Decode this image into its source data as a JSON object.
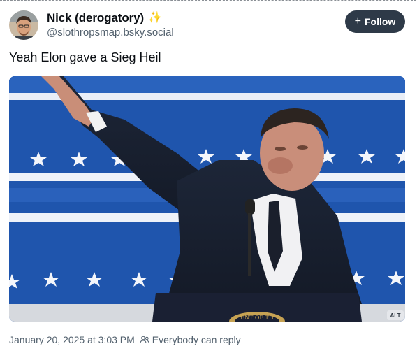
{
  "post": {
    "author": {
      "display_name": "Nick (derogatory)",
      "emoji": "✨",
      "handle": "@slothropsmap.bsky.social",
      "avatar_icon": "avatar-photo"
    },
    "follow_button": {
      "icon": "plus-icon",
      "label": "Follow"
    },
    "text": "Yeah Elon gave a Sieg Heil",
    "media": {
      "alt_badge": "ALT",
      "podium_seal_text": "ENT OF TH"
    },
    "timestamp": "January 20, 2025 at 3:03 PM",
    "reply_setting": {
      "icon": "people-icon",
      "label": "Everybody can reply"
    }
  },
  "colors": {
    "follow_bg": "#2e3a48",
    "backdrop_blue": "#1d4fa3",
    "stripe_white": "#f2f4f8",
    "muted_text": "#52606d"
  }
}
